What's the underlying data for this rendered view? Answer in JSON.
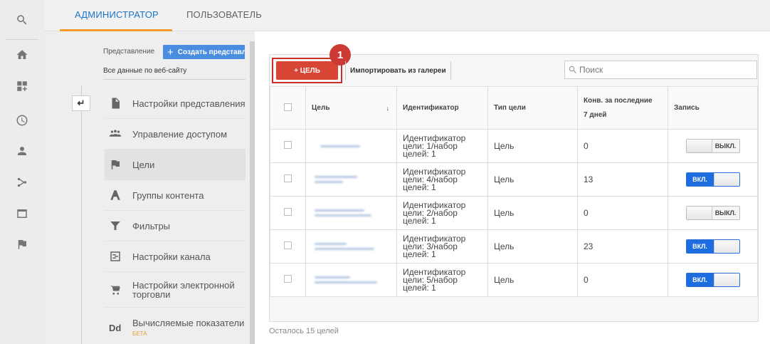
{
  "rail": {
    "icons": [
      "search-icon",
      "home-icon",
      "dashboard-icon",
      "clock-icon",
      "person-icon",
      "share-icon",
      "table-icon",
      "flag-icon"
    ]
  },
  "tabs": [
    {
      "label": "АДМИНИСТРАТОР",
      "active": true
    },
    {
      "label": "ПОЛЬЗОВАТЕЛЬ",
      "active": false
    }
  ],
  "view": {
    "label": "Представление",
    "create_button": "Создать представл",
    "selected": "Все данные по веб-сайту"
  },
  "menu": [
    {
      "label": "Настройки представления",
      "icon": "document-icon"
    },
    {
      "label": "Управление доступом",
      "icon": "people-icon"
    },
    {
      "label": "Цели",
      "icon": "flag-icon",
      "active": true
    },
    {
      "label": "Группы контента",
      "icon": "content-group-icon"
    },
    {
      "label": "Фильтры",
      "icon": "filter-icon"
    },
    {
      "label": "Настройки канала",
      "icon": "channel-icon"
    },
    {
      "label": "Настройки электронной торговли",
      "icon": "cart-icon"
    },
    {
      "label": "Вычисляемые показатели",
      "badge": "БЕТА",
      "icon": "dd-icon"
    }
  ],
  "toolbar": {
    "add_goal": "+ ЦЕЛЬ",
    "step_number": "1",
    "import": "Импортировать из галереи",
    "search_placeholder": "Поиск"
  },
  "table": {
    "headers": {
      "name": "Цель",
      "id": "Идентификатор",
      "type": "Тип цели",
      "conv_line1": "Конв. за последние",
      "conv_line2": "7 дней",
      "record": "Запись"
    },
    "rows": [
      {
        "id_line1": "Идентификатор",
        "id_line2": "цели: 1/набор",
        "id_line3": "целей: 1",
        "type": "Цель",
        "conv": "0",
        "toggle": "ВЫКЛ.",
        "on": false
      },
      {
        "id_line1": "Идентификатор",
        "id_line2": "цели: 4/набор",
        "id_line3": "целей: 1",
        "type": "Цель",
        "conv": "13",
        "toggle": "ВКЛ.",
        "on": true
      },
      {
        "id_line1": "Идентификатор",
        "id_line2": "цели: 2/набор",
        "id_line3": "целей: 1",
        "type": "Цель",
        "conv": "0",
        "toggle": "ВЫКЛ.",
        "on": false
      },
      {
        "id_line1": "Идентификатор",
        "id_line2": "цели: 3/набор",
        "id_line3": "целей: 1",
        "type": "Цель",
        "conv": "23",
        "toggle": "ВКЛ.",
        "on": true
      },
      {
        "id_line1": "Идентификатор",
        "id_line2": "цели: 5/набор",
        "id_line3": "целей: 1",
        "type": "Цель",
        "conv": "0",
        "toggle": "ВКЛ.",
        "on": true
      }
    ]
  },
  "footer": {
    "remaining": "Осталось 15 целей"
  },
  "colors": {
    "accent_blue": "#1a73c9",
    "tab_underline": "#f29a2e",
    "add_goal_red": "#d84535",
    "toggle_on": "#1e6de0"
  }
}
